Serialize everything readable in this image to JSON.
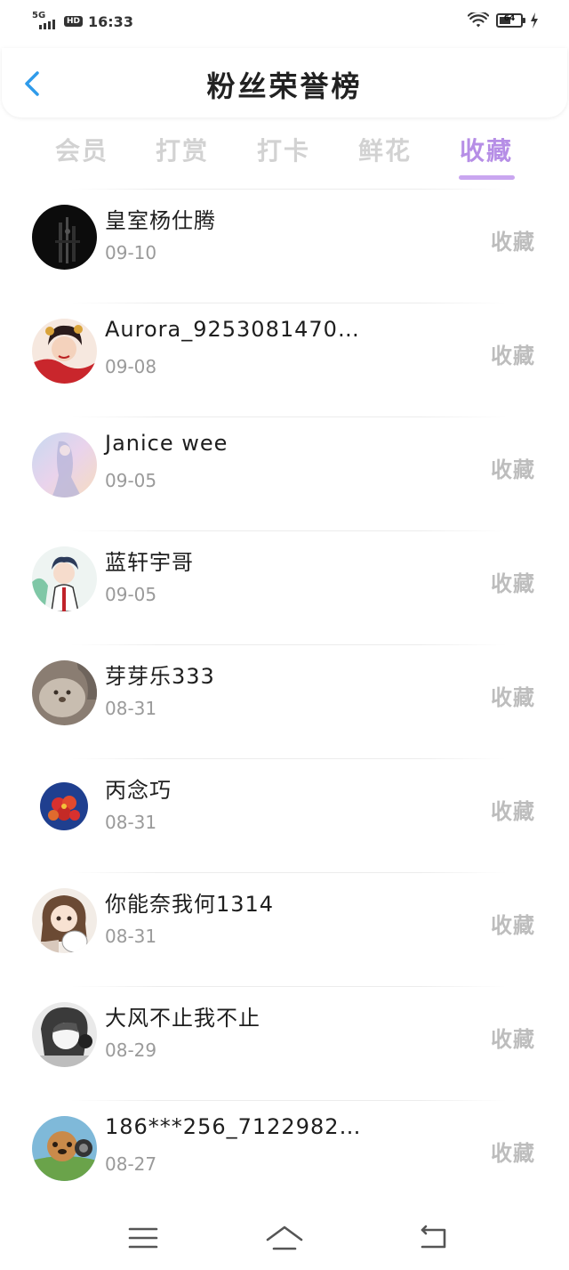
{
  "status_bar": {
    "network": "5G",
    "hd": "HD",
    "time": "16:33",
    "battery": "64"
  },
  "header": {
    "title": "粉丝荣誉榜",
    "back_icon": "chevron-left-icon"
  },
  "tabs": [
    {
      "label": "会员",
      "active": false
    },
    {
      "label": "打赏",
      "active": false
    },
    {
      "label": "打卡",
      "active": false
    },
    {
      "label": "鲜花",
      "active": false
    },
    {
      "label": "收藏",
      "active": true
    }
  ],
  "colors": {
    "accent": "#b68ee6",
    "back_arrow": "#2f9bea",
    "inactive_tab": "#d2d2d2"
  },
  "list": [
    {
      "name": "皇室杨仕腾",
      "date": "09-10",
      "label": "收藏"
    },
    {
      "name": "Aurora_925308147​0…",
      "date": "09-08",
      "label": "收藏"
    },
    {
      "name": "Janice wee",
      "date": "09-05",
      "label": "收藏"
    },
    {
      "name": "蓝轩宇哥",
      "date": "09-05",
      "label": "收藏"
    },
    {
      "name": "芽芽乐333",
      "date": "08-31",
      "label": "收藏"
    },
    {
      "name": "丙念巧",
      "date": "08-31",
      "label": "收藏"
    },
    {
      "name": "你能奈我何1314",
      "date": "08-31",
      "label": "收藏"
    },
    {
      "name": "大风不止我不止",
      "date": "08-29",
      "label": "收藏"
    },
    {
      "name": "186***256_7122982…",
      "date": "08-27",
      "label": "收藏"
    }
  ],
  "nav_bar": {
    "items": [
      "menu-icon",
      "home-icon",
      "back-icon"
    ]
  }
}
